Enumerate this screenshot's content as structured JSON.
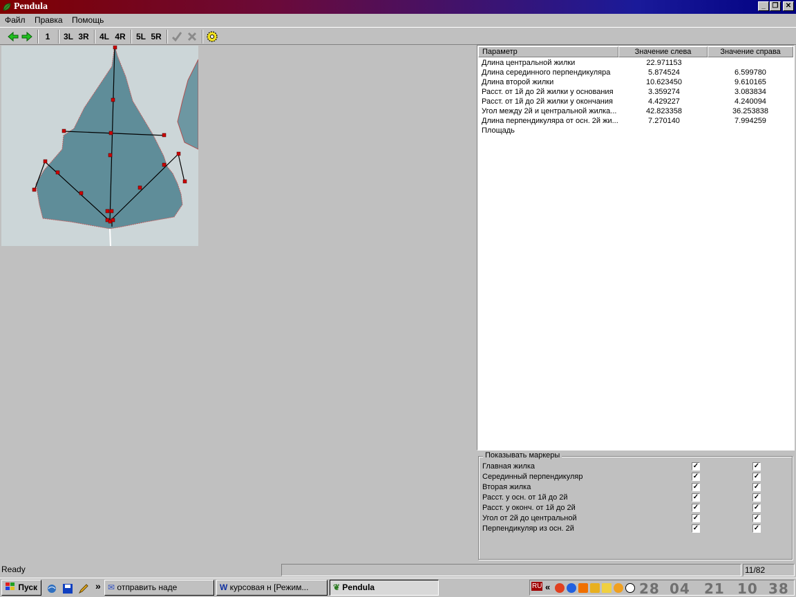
{
  "window": {
    "title": "Pendula"
  },
  "menu": [
    "Файл",
    "Правка",
    "Помощь"
  ],
  "toolbar": {
    "labels": [
      "1",
      "3L",
      "3R",
      "4L",
      "4R",
      "5L",
      "5R"
    ]
  },
  "table": {
    "headers": [
      "Параметр",
      "Значение слева",
      "Значение справа"
    ],
    "rows": [
      [
        "Длина центральной жилки",
        "22.971153",
        ""
      ],
      [
        "Длина серединного перпендикуляра",
        "5.874524",
        "6.599780"
      ],
      [
        "Длина второй жилки",
        "10.623450",
        "9.610165"
      ],
      [
        "Расст. от 1й до 2й жилки у основания",
        "3.359274",
        "3.083834"
      ],
      [
        "Расст. от 1й до 2й жилки у окончания",
        "4.429227",
        "4.240094"
      ],
      [
        "Угол между 2й и центральной жилка...",
        "42.823358",
        "36.253838"
      ],
      [
        "Длина перпендикуляра от осн. 2й жи...",
        "7.270140",
        "7.994259"
      ],
      [
        "Площадь",
        "",
        ""
      ]
    ]
  },
  "markers": {
    "title": "Показывать маркеры",
    "items": [
      {
        "label": "Главная жилка",
        "left": true,
        "right": true
      },
      {
        "label": "Серединный перпендикуляр",
        "left": true,
        "right": true
      },
      {
        "label": "Вторая жилка",
        "left": true,
        "right": true
      },
      {
        "label": "Расст. у осн. от 1й до 2й",
        "left": true,
        "right": true
      },
      {
        "label": "Расст. у оконч. от 1й до 2й",
        "left": true,
        "right": true
      },
      {
        "label": "Угол от 2й до центральной",
        "left": true,
        "right": true
      },
      {
        "label": "Перпендикуляр из осн. 2й",
        "left": true,
        "right": true
      }
    ]
  },
  "status": {
    "text": "Ready",
    "page": "11/82"
  },
  "taskbar": {
    "start": "Пуск",
    "chevron": "»",
    "tasks": [
      "отправить наде",
      "курсовая н [Режим...",
      "Pendula"
    ],
    "lang": "RU",
    "tray_chevron": "«",
    "clock": [
      "28",
      "04",
      "21",
      "10",
      "38"
    ]
  },
  "colors": {
    "marker": "#cc0000",
    "leaf": "#5f8d99",
    "title_left": "#800000",
    "title_right": "#000080"
  }
}
